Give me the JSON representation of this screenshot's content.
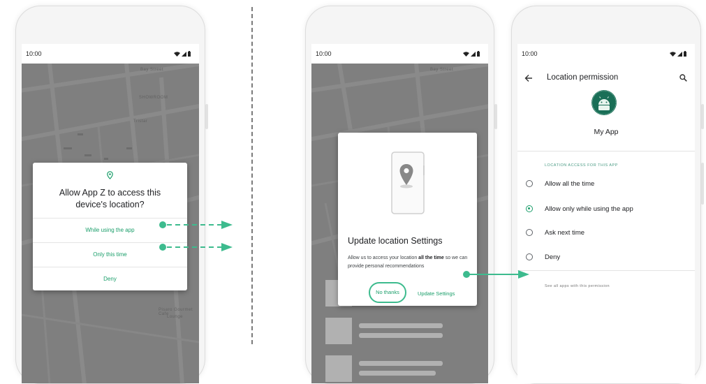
{
  "colors": {
    "accent": "#1a9e6a",
    "accent_outline": "#3dbb8e",
    "map": "#8a8a8a",
    "app_icon": "#1a6f57"
  },
  "status": {
    "time": "10:00",
    "icons": [
      "wifi-icon",
      "signal-icon",
      "battery-icon"
    ]
  },
  "phone1": {
    "map_labels": [
      "Bay Street",
      "SHOWROOM",
      "Tristar",
      "Pisaro Gourmet Cafe",
      "Lounge"
    ],
    "dialog": {
      "icon": "location-pin-icon",
      "title_line1": "Allow App Z to access this",
      "title_line2": "device's location?",
      "options": [
        "While using the app",
        "Only this time",
        "Deny"
      ]
    }
  },
  "phone2": {
    "map_labels": [
      "Bay Street"
    ],
    "dialog": {
      "illustration": "location-pin-icon",
      "title": "Update location Settings",
      "body_before": "Allow us to access your location ",
      "body_bold1": "all the",
      "body_bold2": "time",
      "body_after": " so we can provide personal recommendations",
      "no_thanks": "No thanks",
      "update": "Update  Settings"
    }
  },
  "phone3": {
    "header": {
      "back_icon": "back-arrow-icon",
      "title": "Location permission",
      "search_icon": "search-icon"
    },
    "app": {
      "icon": "android-robot-icon",
      "name": "My App"
    },
    "section_label": "LOCATION ACCESS FOR THIS APP",
    "options": [
      {
        "label": "Allow all the time",
        "selected": false
      },
      {
        "label": "Allow only while using the app",
        "selected": true
      },
      {
        "label": "Ask next time",
        "selected": false
      },
      {
        "label": "Deny",
        "selected": false
      }
    ],
    "see_all": "See all apps with this permission"
  }
}
